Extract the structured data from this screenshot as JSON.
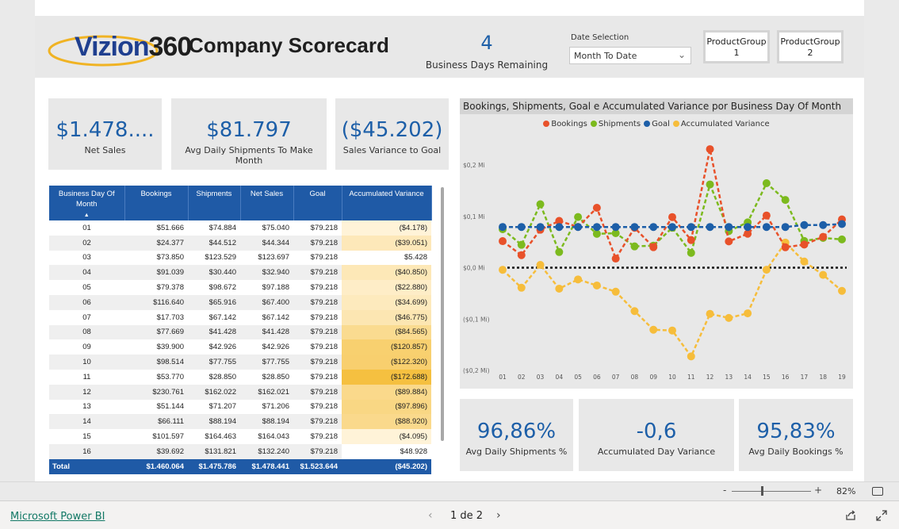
{
  "header": {
    "logo_text_a": "Vizion",
    "logo_text_b": "360",
    "title": "Company Scorecard",
    "days_remaining": "4",
    "days_remaining_label": "Business Days Remaining",
    "date_selection_label": "Date Selection",
    "date_selection_value": "Month To Date",
    "product_groups": [
      {
        "line1": "ProductGroup",
        "line2": "1"
      },
      {
        "line1": "ProductGroup",
        "line2": "2"
      }
    ]
  },
  "kpis_top": [
    {
      "value": "$1.478....",
      "label": "Net Sales"
    },
    {
      "value": "$81.797",
      "label": "Avg Daily Shipments To Make Month"
    },
    {
      "value": "($45.202)",
      "label": "Sales Variance to Goal"
    }
  ],
  "kpis_bottom": [
    {
      "value": "96,86%",
      "label": "Avg Daily Shipments %"
    },
    {
      "value": "-0,6",
      "label": "Accumulated Day Variance"
    },
    {
      "value": "95,83%",
      "label": "Avg Daily Bookings %"
    }
  ],
  "table": {
    "columns": [
      "Business Day Of Month",
      "Bookings",
      "Shipments",
      "Net Sales",
      "Goal",
      "Accumulated Variance"
    ],
    "rows": [
      [
        "01",
        "$51.666",
        "$74.884",
        "$75.040",
        "$79.218",
        "($4.178)"
      ],
      [
        "02",
        "$24.377",
        "$44.512",
        "$44.344",
        "$79.218",
        "($39.051)"
      ],
      [
        "03",
        "$73.850",
        "$123.529",
        "$123.697",
        "$79.218",
        "$5.428"
      ],
      [
        "04",
        "$91.039",
        "$30.440",
        "$32.940",
        "$79.218",
        "($40.850)"
      ],
      [
        "05",
        "$79.378",
        "$98.672",
        "$97.188",
        "$79.218",
        "($22.880)"
      ],
      [
        "06",
        "$116.640",
        "$65.916",
        "$67.400",
        "$79.218",
        "($34.699)"
      ],
      [
        "07",
        "$17.703",
        "$67.142",
        "$67.142",
        "$79.218",
        "($46.775)"
      ],
      [
        "08",
        "$77.669",
        "$41.428",
        "$41.428",
        "$79.218",
        "($84.565)"
      ],
      [
        "09",
        "$39.900",
        "$42.926",
        "$42.926",
        "$79.218",
        "($120.857)"
      ],
      [
        "10",
        "$98.514",
        "$77.755",
        "$77.755",
        "$79.218",
        "($122.320)"
      ],
      [
        "11",
        "$53.770",
        "$28.850",
        "$28.850",
        "$79.218",
        "($172.688)"
      ],
      [
        "12",
        "$230.761",
        "$162.022",
        "$162.021",
        "$79.218",
        "($89.884)"
      ],
      [
        "13",
        "$51.144",
        "$71.207",
        "$71.206",
        "$79.218",
        "($97.896)"
      ],
      [
        "14",
        "$66.111",
        "$88.194",
        "$88.194",
        "$79.218",
        "($88.920)"
      ],
      [
        "15",
        "$101.597",
        "$164.463",
        "$164.043",
        "$79.218",
        "($4.095)"
      ],
      [
        "16",
        "$39.692",
        "$131.821",
        "$132.240",
        "$79.218",
        "$48.928"
      ]
    ],
    "variance_values": [
      -4178,
      -39051,
      5428,
      -40850,
      -22880,
      -34699,
      -46775,
      -84565,
      -120857,
      -122320,
      -172688,
      -89884,
      -97896,
      -88920,
      -4095,
      48928
    ],
    "total": [
      "Total",
      "$1.460.064",
      "$1.475.786",
      "$1.478.441",
      "$1.523.644",
      "($45.202)"
    ]
  },
  "chart_data": {
    "type": "line",
    "title": "Bookings, Shipments, Goal e Accumulated Variance por Business Day Of Month",
    "categories": [
      "01",
      "02",
      "03",
      "04",
      "05",
      "06",
      "07",
      "08",
      "09",
      "10",
      "11",
      "12",
      "13",
      "14",
      "15",
      "16",
      "17",
      "18",
      "19"
    ],
    "y_ticks": [
      "$0,2 Mi",
      "$0,1 Mi",
      "$0,0 Mi",
      "($0,1 Mi)",
      "($0,2 Mi)"
    ],
    "ylim": [
      -200000,
      200000
    ],
    "reference_line": 0,
    "series": [
      {
        "name": "Bookings",
        "color": "#e8512a",
        "values": [
          51666,
          24377,
          73850,
          91039,
          79378,
          116640,
          17703,
          77669,
          39900,
          98514,
          53770,
          230761,
          51144,
          66111,
          101597,
          39692,
          45000,
          60000,
          94000
        ]
      },
      {
        "name": "Shipments",
        "color": "#7cba1e",
        "values": [
          74884,
          44512,
          123529,
          30440,
          98672,
          65916,
          67142,
          41428,
          42926,
          77755,
          28850,
          162022,
          71207,
          88194,
          164463,
          131821,
          52000,
          58000,
          55000
        ]
      },
      {
        "name": "Goal",
        "color": "#1d5fa8",
        "values": [
          79218,
          79218,
          79218,
          79218,
          79218,
          79218,
          79218,
          79218,
          79218,
          79218,
          79218,
          79218,
          79218,
          79218,
          79218,
          79218,
          83000,
          83000,
          85000
        ]
      },
      {
        "name": "Accumulated Variance",
        "color": "#f6bd3b",
        "values": [
          -4178,
          -39051,
          5428,
          -40850,
          -22880,
          -34699,
          -46775,
          -84565,
          -120857,
          -122320,
          -172688,
          -89884,
          -97896,
          -88920,
          -4095,
          48928,
          12000,
          -14000,
          -45202
        ]
      }
    ],
    "legend_position": "top-center",
    "grid": false
  },
  "footer": {
    "zoom_minus": "-",
    "zoom_plus": "+",
    "zoom": "82%",
    "brand": "Microsoft Power BI",
    "page_indicator": "1 de 2",
    "prev": "‹",
    "next": "›"
  }
}
